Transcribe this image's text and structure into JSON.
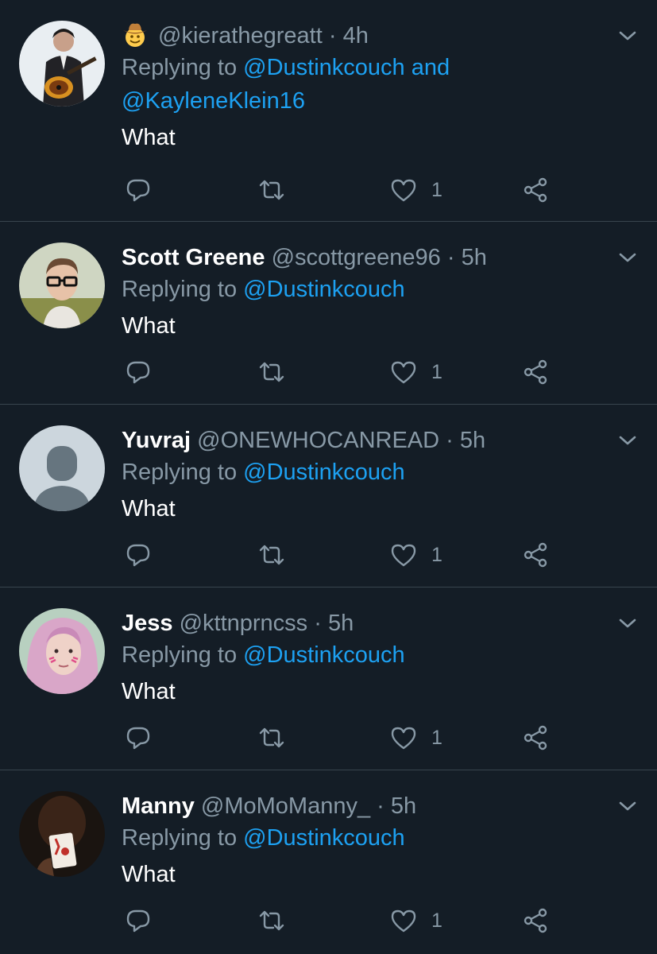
{
  "tweets": [
    {
      "name": "",
      "has_emoji": true,
      "handle": "@kierathegreatt",
      "time": "4h",
      "replying_prefix": "Replying to",
      "mention1": "@Dustinkcouch and",
      "mention2": "@KayleneKlein16",
      "text": "What",
      "likes": "1",
      "avatar": "guitar-player-photo"
    },
    {
      "name": "Scott Greene",
      "handle": "@scottgreene96",
      "time": "5h",
      "replying_prefix": "Replying to",
      "mention1": "@Dustinkcouch",
      "text": "What",
      "likes": "1",
      "avatar": "glasses-man-photo"
    },
    {
      "name": "Yuvraj",
      "handle": "@ONEWHOCANREAD",
      "time": "5h",
      "replying_prefix": "Replying to",
      "mention1": "@Dustinkcouch",
      "text": "What",
      "likes": "1",
      "avatar": "default-profile-silhouette"
    },
    {
      "name": "Jess",
      "handle": "@kttnprncss",
      "time": "5h",
      "replying_prefix": "Replying to",
      "mention1": "@Dustinkcouch",
      "text": "What",
      "likes": "1",
      "avatar": "pink-hair-photo"
    },
    {
      "name": "Manny",
      "handle": "@MoMoManny_",
      "time": "5h",
      "replying_prefix": "Replying to",
      "mention1": "@Dustinkcouch",
      "text": "What",
      "likes": "1",
      "avatar": "playing-card-photo"
    }
  ],
  "colors": {
    "background": "#141d26",
    "secondary_text": "#8899a6",
    "link": "#1da1f2",
    "divider": "#38444d"
  },
  "icons": {
    "reply": "reply-icon",
    "retweet": "retweet-icon",
    "like": "heart-icon",
    "share": "share-icon",
    "menu": "chevron-down-icon",
    "emoji": "cowboy-emoji-icon"
  }
}
